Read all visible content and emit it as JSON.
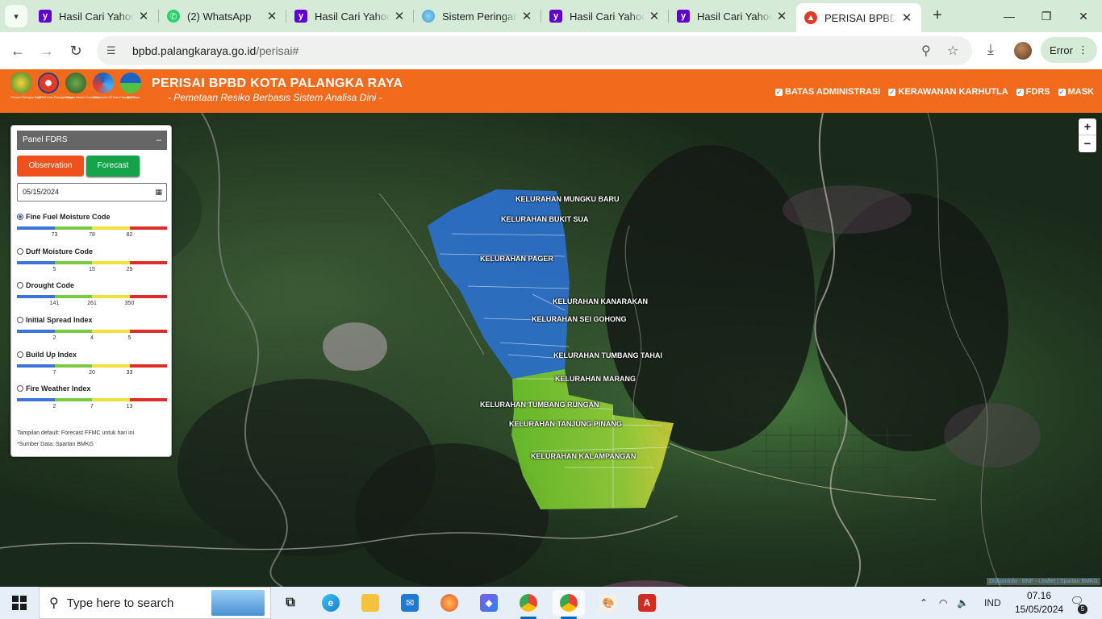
{
  "browser": {
    "tabs": [
      {
        "title": "Hasil Cari Yahoo",
        "favicon": "yahoo-icon"
      },
      {
        "title": "(2) WhatsApp",
        "favicon": "whatsapp-icon"
      },
      {
        "title": "Hasil Cari Yahoo",
        "favicon": "yahoo-icon"
      },
      {
        "title": "Sistem Peringatan",
        "favicon": "globe-icon"
      },
      {
        "title": "Hasil Cari Yahoo",
        "favicon": "yahoo-icon"
      },
      {
        "title": "Hasil Cari Yahoo",
        "favicon": "yahoo-icon"
      },
      {
        "title": "PERISAI BPBD Kota",
        "favicon": "bpbd-icon"
      }
    ],
    "active_tab": 6,
    "url_host": "bpbd.palangkaraya.go.id",
    "url_path": "/perisai#",
    "error_label": "Error"
  },
  "header": {
    "logos": [
      {
        "name": "pemkot-logo",
        "caption": "Pemkot Palangka Raya"
      },
      {
        "name": "bpbd-logo",
        "caption": "BPBD Kota Palangka Raya"
      },
      {
        "name": "borneo-logo",
        "caption": "Borneo Nature Foundation"
      },
      {
        "name": "diskominfo-logo",
        "caption": "Diskominfo SP Kota Palangka Raya"
      },
      {
        "name": "bmkg-logo",
        "caption": "BMKG"
      }
    ],
    "title": "PERISAI BPBD KOTA PALANGKA RAYA",
    "subtitle": "- Pemetaan Resiko Berbasis Sistem Analisa Dini -",
    "layers": [
      {
        "label": "BATAS ADMINISTRASI",
        "checked": true
      },
      {
        "label": "KERAWANAN KARHUTLA",
        "checked": true
      },
      {
        "label": "FDRS",
        "checked": true
      },
      {
        "label": "MASK",
        "checked": true
      }
    ]
  },
  "panel": {
    "title": "Panel FDRS",
    "minimize": "–",
    "observation_label": "Observation",
    "forecast_label": "Forecast",
    "date_value": "05/15/2024",
    "indices": [
      {
        "name": "Fine Fuel Moisture Code",
        "selected": true,
        "ticks": [
          "73",
          "78",
          "82"
        ]
      },
      {
        "name": "Duff Moisture Code",
        "selected": false,
        "ticks": [
          "5",
          "15",
          "29"
        ]
      },
      {
        "name": "Drought Code",
        "selected": false,
        "ticks": [
          "141",
          "261",
          "350"
        ]
      },
      {
        "name": "Initial Spread Index",
        "selected": false,
        "ticks": [
          "2",
          "4",
          "5"
        ]
      },
      {
        "name": "Build Up Index",
        "selected": false,
        "ticks": [
          "7",
          "20",
          "33"
        ]
      },
      {
        "name": "Fire Weather Index",
        "selected": false,
        "ticks": [
          "2",
          "7",
          "13"
        ]
      }
    ],
    "scale_colors": [
      "#3b73d9",
      "#7ac943",
      "#f2e13b",
      "#e02b2b"
    ],
    "note_default": "Tampilan default: Forecast FFMC untuk hari ini",
    "note_source": "*Sumber Data: Spartan BMKG"
  },
  "map": {
    "regions": [
      "KELURAHAN MUNGKU BARU",
      "KELURAHAN BUKIT SUA",
      "KELURAHAN PAGER",
      "KELURAHAN KANARAKAN",
      "KELURAHAN SEI GOHONG",
      "KELURAHAN TUMBANG TAHAI",
      "KELURAHAN MARANG",
      "KELURAHAN TUMBANG RUNGAN",
      "KELURAHAN TANJUNG PINANG",
      "KELURAHAN KALAMPANGAN"
    ],
    "zoom_in": "+",
    "zoom_out": "−",
    "attribution": "Diskominfo - BNF - Leaflet | Spartan BMKG"
  },
  "taskbar": {
    "search_placeholder": "Type here to search",
    "language": "IND",
    "time": "07.16",
    "date": "15/05/2024",
    "notifications": "5"
  }
}
